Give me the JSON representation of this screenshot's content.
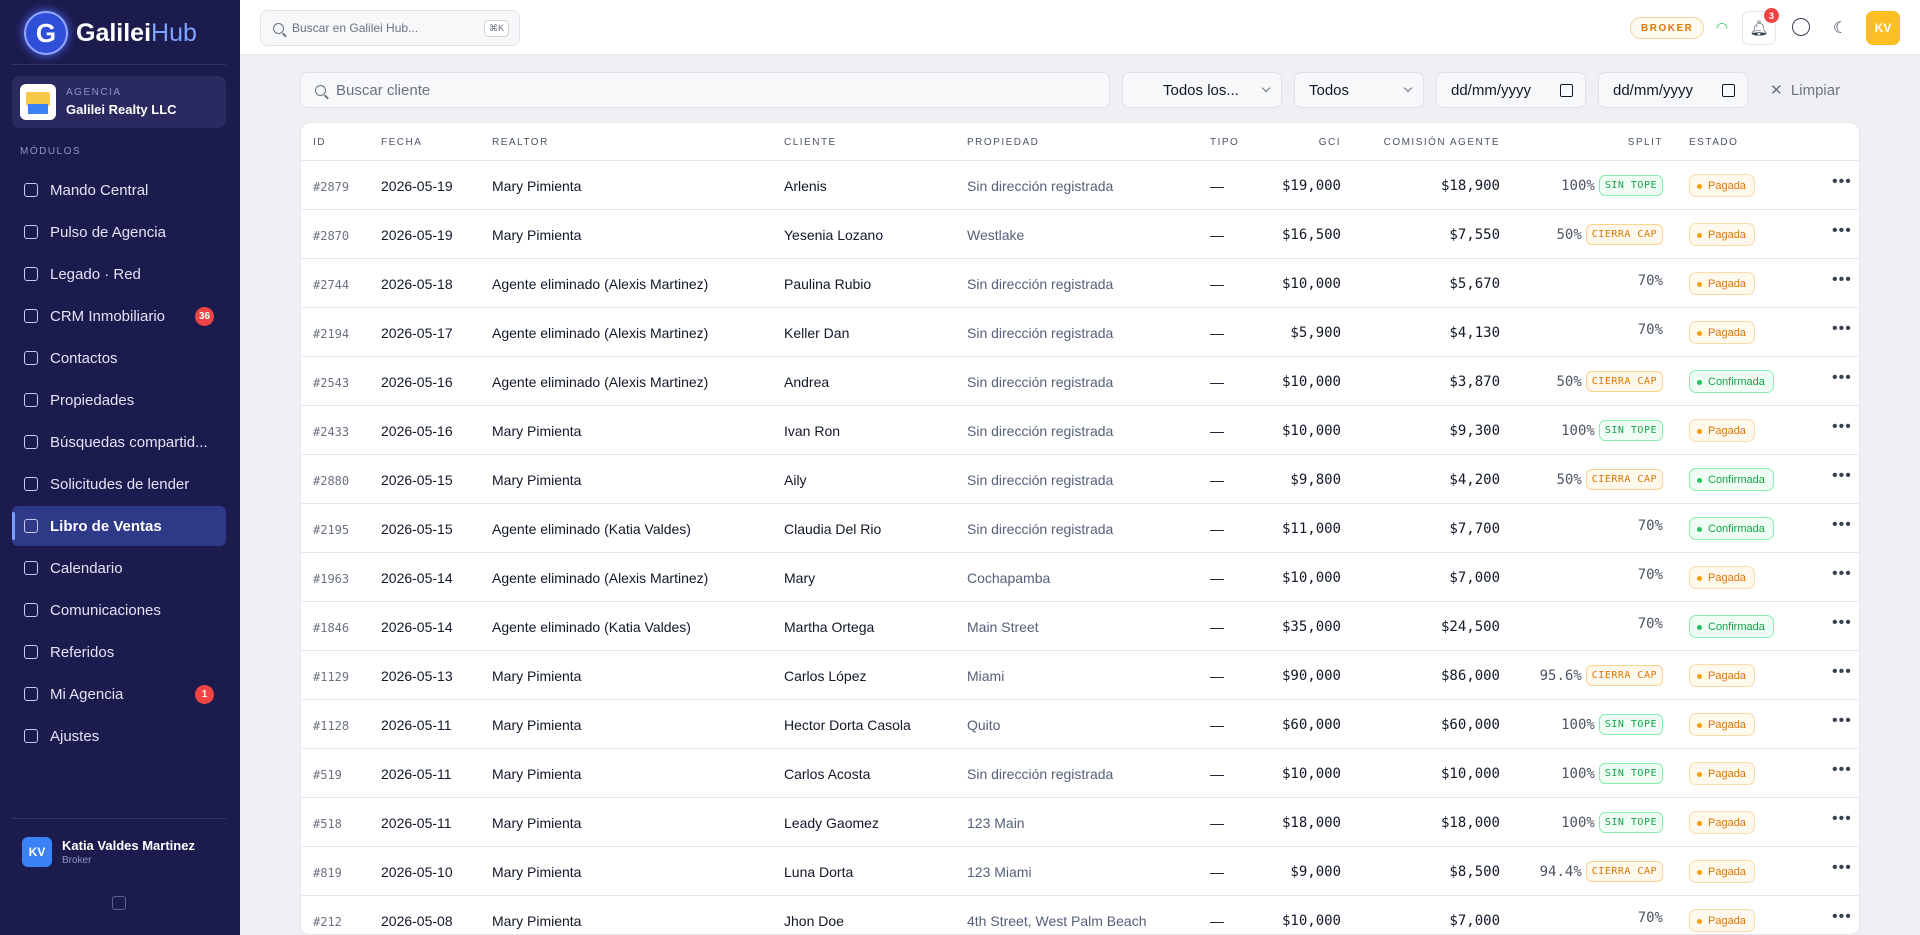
{
  "brand": {
    "name": "Galilei",
    "suffix": "Hub",
    "logo_letter": "G"
  },
  "agency": {
    "label": "AGENCIA",
    "name": "Galilei Realty LLC"
  },
  "modules_title": "MÓDULOS",
  "nav": [
    {
      "label": "Mando Central",
      "icon": "shield-icon"
    },
    {
      "label": "Pulso de Agencia",
      "icon": "pulse-icon"
    },
    {
      "label": "Legado · Red",
      "icon": "network-icon"
    },
    {
      "label": "CRM Inmobiliario",
      "icon": "users-icon",
      "badge": "36"
    },
    {
      "label": "Contactos",
      "icon": "contacts-icon"
    },
    {
      "label": "Propiedades",
      "icon": "home-icon"
    },
    {
      "label": "Búsquedas compartid...",
      "icon": "share-icon"
    },
    {
      "label": "Solicitudes de lender",
      "icon": "bank-icon"
    },
    {
      "label": "Libro de Ventas",
      "icon": "book-icon",
      "active": true
    },
    {
      "label": "Calendario",
      "icon": "calendar-icon"
    },
    {
      "label": "Comunicaciones",
      "icon": "mail-icon"
    },
    {
      "label": "Referidos",
      "icon": "referral-icon"
    },
    {
      "label": "Mi Agencia",
      "icon": "agency-icon",
      "badge": "1"
    },
    {
      "label": "Ajustes",
      "icon": "settings-icon"
    }
  ],
  "user": {
    "initials": "KV",
    "name": "Katia Valdes Martinez",
    "role": "Broker"
  },
  "topbar": {
    "search_placeholder": "Buscar en Galilei Hub...",
    "shortcut": "⌘K",
    "role_badge": "BROKER",
    "notif_count": "3",
    "avatar": "KV"
  },
  "filters": {
    "client_placeholder": "Buscar cliente",
    "select1": "Todos los...",
    "select2": "Todos",
    "date1": "dd/mm/yyyy",
    "date2": "dd/mm/yyyy",
    "clear": "Limpiar"
  },
  "columns": [
    "ID",
    "FECHA",
    "REALTOR",
    "CLIENTE",
    "PROPIEDAD",
    "TIPO",
    "GCI",
    "COMISIÓN AGENTE",
    "SPLIT",
    "ESTADO"
  ],
  "rows": [
    {
      "id": "#2879",
      "fecha": "2026-05-19",
      "realtor": "Mary Pimienta",
      "cliente": "Arlenis",
      "propiedad": "Sin dirección registrada",
      "tipo": "—",
      "gci": "$19,000",
      "comision": "$18,900",
      "split": "100%",
      "cap": "SIN TOPE",
      "cap_type": "green",
      "estado": "Pagada",
      "estado_type": "paid"
    },
    {
      "id": "#2870",
      "fecha": "2026-05-19",
      "realtor": "Mary Pimienta",
      "cliente": "Yesenia Lozano",
      "propiedad": "Westlake",
      "tipo": "—",
      "gci": "$16,500",
      "comision": "$7,550",
      "split": "50%",
      "cap": "CIERRA CAP",
      "cap_type": "orange",
      "estado": "Pagada",
      "estado_type": "paid"
    },
    {
      "id": "#2744",
      "fecha": "2026-05-18",
      "realtor": "Agente eliminado (Alexis Martinez)",
      "cliente": "Paulina Rubio",
      "propiedad": "Sin dirección registrada",
      "tipo": "—",
      "gci": "$10,000",
      "comision": "$5,670",
      "split": "70%",
      "cap": "",
      "cap_type": "",
      "estado": "Pagada",
      "estado_type": "paid"
    },
    {
      "id": "#2194",
      "fecha": "2026-05-17",
      "realtor": "Agente eliminado (Alexis Martinez)",
      "cliente": "Keller Dan",
      "propiedad": "Sin dirección registrada",
      "tipo": "—",
      "gci": "$5,900",
      "comision": "$4,130",
      "split": "70%",
      "cap": "",
      "cap_type": "",
      "estado": "Pagada",
      "estado_type": "paid"
    },
    {
      "id": "#2543",
      "fecha": "2026-05-16",
      "realtor": "Agente eliminado (Alexis Martinez)",
      "cliente": "Andrea",
      "propiedad": "Sin dirección registrada",
      "tipo": "—",
      "gci": "$10,000",
      "comision": "$3,870",
      "split": "50%",
      "cap": "CIERRA CAP",
      "cap_type": "orange",
      "estado": "Confirmada",
      "estado_type": "conf"
    },
    {
      "id": "#2433",
      "fecha": "2026-05-16",
      "realtor": "Mary Pimienta",
      "cliente": "Ivan Ron",
      "propiedad": "Sin dirección registrada",
      "tipo": "—",
      "gci": "$10,000",
      "comision": "$9,300",
      "split": "100%",
      "cap": "SIN TOPE",
      "cap_type": "green",
      "estado": "Pagada",
      "estado_type": "paid"
    },
    {
      "id": "#2880",
      "fecha": "2026-05-15",
      "realtor": "Mary Pimienta",
      "cliente": "Aily",
      "propiedad": "Sin dirección registrada",
      "tipo": "—",
      "gci": "$9,800",
      "comision": "$4,200",
      "split": "50%",
      "cap": "CIERRA CAP",
      "cap_type": "orange",
      "estado": "Confirmada",
      "estado_type": "conf"
    },
    {
      "id": "#2195",
      "fecha": "2026-05-15",
      "realtor": "Agente eliminado (Katia Valdes)",
      "cliente": "Claudia Del Rio",
      "propiedad": "Sin dirección registrada",
      "tipo": "—",
      "gci": "$11,000",
      "comision": "$7,700",
      "split": "70%",
      "cap": "",
      "cap_type": "",
      "estado": "Confirmada",
      "estado_type": "conf"
    },
    {
      "id": "#1963",
      "fecha": "2026-05-14",
      "realtor": "Agente eliminado (Alexis Martinez)",
      "cliente": "Mary",
      "propiedad": "Cochapamba",
      "tipo": "—",
      "gci": "$10,000",
      "comision": "$7,000",
      "split": "70%",
      "cap": "",
      "cap_type": "",
      "estado": "Pagada",
      "estado_type": "paid"
    },
    {
      "id": "#1846",
      "fecha": "2026-05-14",
      "realtor": "Agente eliminado (Katia Valdes)",
      "cliente": "Martha Ortega",
      "propiedad": "Main Street",
      "tipo": "—",
      "gci": "$35,000",
      "comision": "$24,500",
      "split": "70%",
      "cap": "",
      "cap_type": "",
      "estado": "Confirmada",
      "estado_type": "conf"
    },
    {
      "id": "#1129",
      "fecha": "2026-05-13",
      "realtor": "Mary Pimienta",
      "cliente": "Carlos López",
      "propiedad": "Miami",
      "tipo": "—",
      "gci": "$90,000",
      "comision": "$86,000",
      "split": "95.6%",
      "cap": "CIERRA CAP",
      "cap_type": "orange",
      "estado": "Pagada",
      "estado_type": "paid"
    },
    {
      "id": "#1128",
      "fecha": "2026-05-11",
      "realtor": "Mary Pimienta",
      "cliente": "Hector Dorta Casola",
      "propiedad": "Quito",
      "tipo": "—",
      "gci": "$60,000",
      "comision": "$60,000",
      "split": "100%",
      "cap": "SIN TOPE",
      "cap_type": "green",
      "estado": "Pagada",
      "estado_type": "paid"
    },
    {
      "id": "#519",
      "fecha": "2026-05-11",
      "realtor": "Mary Pimienta",
      "cliente": "Carlos Acosta",
      "propiedad": "Sin dirección registrada",
      "tipo": "—",
      "gci": "$10,000",
      "comision": "$10,000",
      "split": "100%",
      "cap": "SIN TOPE",
      "cap_type": "green",
      "estado": "Pagada",
      "estado_type": "paid"
    },
    {
      "id": "#518",
      "fecha": "2026-05-11",
      "realtor": "Mary Pimienta",
      "cliente": "Leady Gaomez",
      "propiedad": "123 Main",
      "tipo": "—",
      "gci": "$18,000",
      "comision": "$18,000",
      "split": "100%",
      "cap": "SIN TOPE",
      "cap_type": "green",
      "estado": "Pagada",
      "estado_type": "paid"
    },
    {
      "id": "#819",
      "fecha": "2026-05-10",
      "realtor": "Mary Pimienta",
      "cliente": "Luna Dorta",
      "propiedad": "123 Miami",
      "tipo": "—",
      "gci": "$9,000",
      "comision": "$8,500",
      "split": "94.4%",
      "cap": "CIERRA CAP",
      "cap_type": "orange",
      "estado": "Pagada",
      "estado_type": "paid"
    },
    {
      "id": "#212",
      "fecha": "2026-05-08",
      "realtor": "Mary Pimienta",
      "cliente": "Jhon Doe",
      "propiedad": "4th Street, West Palm Beach",
      "tipo": "—",
      "gci": "$10,000",
      "comision": "$7,000",
      "split": "70%",
      "cap": "",
      "cap_type": "",
      "estado": "Pagada",
      "estado_type": "paid"
    }
  ]
}
